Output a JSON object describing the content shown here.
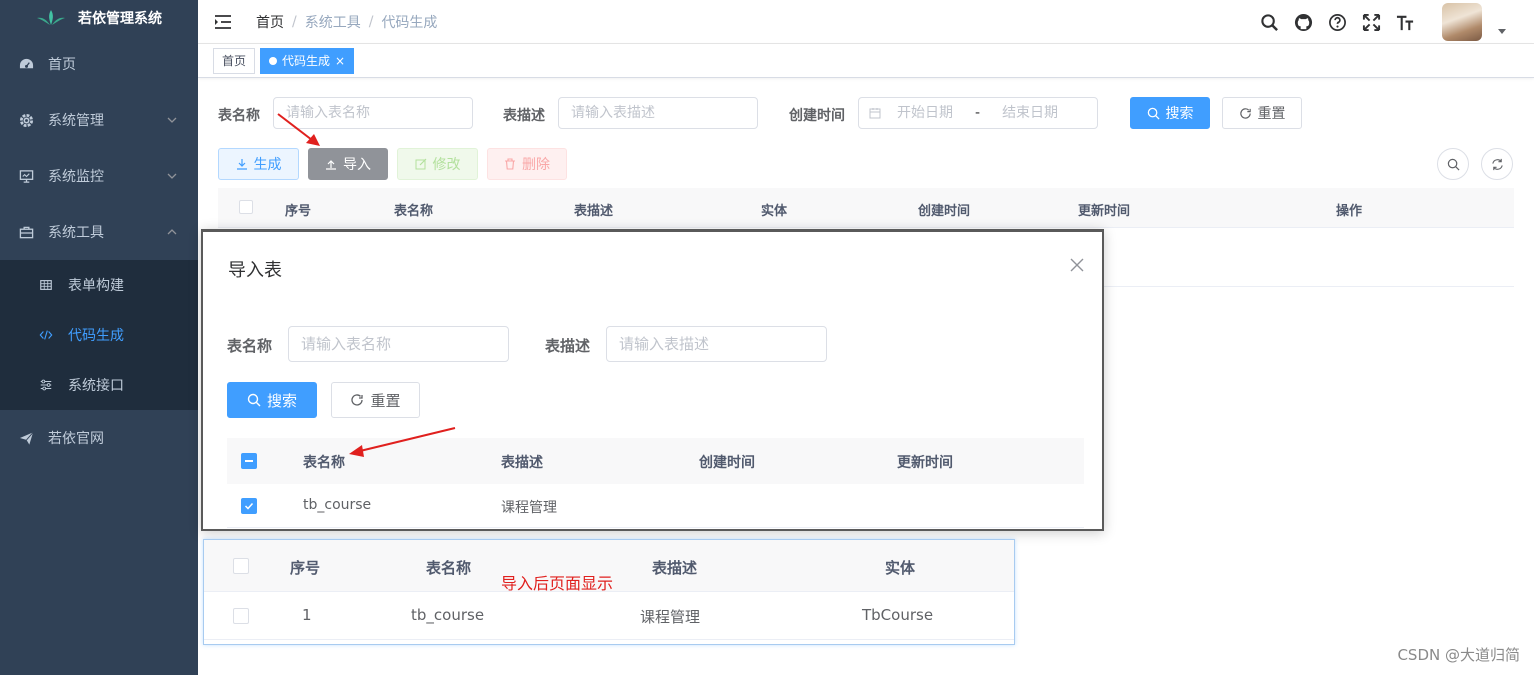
{
  "app": {
    "title": "若依管理系统"
  },
  "sidebar": {
    "items": [
      {
        "label": "首页",
        "icon": "dashboard-icon"
      },
      {
        "label": "系统管理",
        "icon": "gear-icon"
      },
      {
        "label": "系统监控",
        "icon": "monitor-icon"
      },
      {
        "label": "系统工具",
        "icon": "toolbox-icon"
      }
    ],
    "sub_items": [
      {
        "label": "表单构建",
        "icon": "table-icon"
      },
      {
        "label": "代码生成",
        "icon": "code-icon"
      },
      {
        "label": "系统接口",
        "icon": "sliders-icon"
      }
    ],
    "official": {
      "label": "若依官网",
      "icon": "send-icon"
    }
  },
  "breadcrumb": {
    "home": "首页",
    "sep": "/",
    "tools": "系统工具",
    "current": "代码生成"
  },
  "tags": {
    "home": "首页",
    "current": "代码生成",
    "close": "×"
  },
  "search": {
    "table_name_label": "表名称",
    "table_name_placeholder": "请输入表名称",
    "table_desc_label": "表描述",
    "table_desc_placeholder": "请输入表描述",
    "created_label": "创建时间",
    "start_placeholder": "开始日期",
    "range_sep": "-",
    "end_placeholder": "结束日期",
    "search_btn": "搜索",
    "reset_btn": "重置"
  },
  "toolbar": {
    "generate": "生成",
    "import": "导入",
    "edit": "修改",
    "delete": "删除"
  },
  "table": {
    "headers": [
      "序号",
      "表名称",
      "表描述",
      "实体",
      "创建时间",
      "更新时间",
      "操作"
    ]
  },
  "dialog": {
    "title": "导入表",
    "table_name_label": "表名称",
    "table_name_placeholder": "请输入表名称",
    "table_desc_label": "表描述",
    "table_desc_placeholder": "请输入表描述",
    "search_btn": "搜索",
    "reset_btn": "重置",
    "headers": [
      "表名称",
      "表描述",
      "创建时间",
      "更新时间"
    ],
    "rows": [
      {
        "table_name": "tb_course",
        "table_desc": "课程管理",
        "created": "",
        "updated": ""
      }
    ]
  },
  "result": {
    "annotation": "导入后页面显示",
    "headers": [
      "序号",
      "表名称",
      "表描述",
      "实体"
    ],
    "rows": [
      {
        "index": "1",
        "table_name": "tb_course",
        "table_desc": "课程管理",
        "entity": "TbCourse"
      }
    ]
  },
  "watermark": "CSDN @大道归简",
  "colors": {
    "primary": "#409eff",
    "sidebar_bg": "#304156",
    "submenu_bg": "#1f2d3d",
    "annotation": "#e0201e"
  }
}
